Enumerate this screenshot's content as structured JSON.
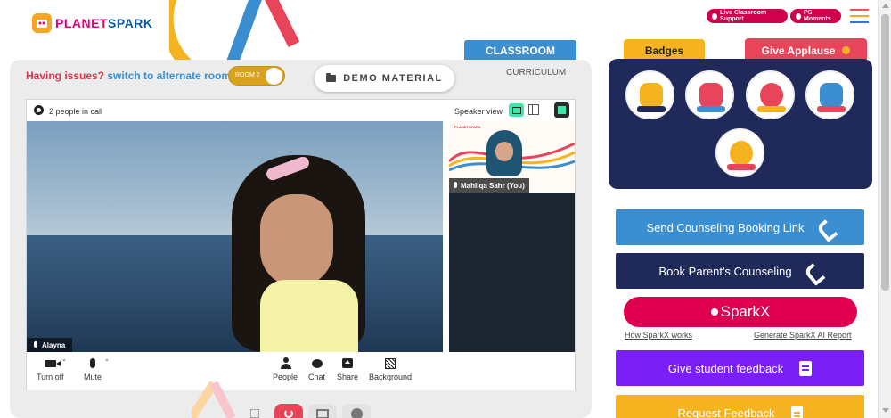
{
  "brand": {
    "logo_part1": "PLANET",
    "logo_part2": "SPARK"
  },
  "header": {
    "live_support": "Live Classroom Support",
    "ps_moments": "PS Moments"
  },
  "tabs": {
    "classroom": "CLASSROOM",
    "curriculum": "CURRICULUM"
  },
  "issues": {
    "prefix": "Having issues?",
    "link": "switch to alternate room"
  },
  "room_toggle": {
    "label": "ROOM 2"
  },
  "demo_material": "DEMO MATERIAL",
  "call": {
    "people_count": "2 people in call",
    "view_mode": "Speaker view",
    "main_participant": "Alayna",
    "side_participant": "Mahliqa Sahr (You)",
    "side_logo": "PLANETSPARK"
  },
  "toolbar": {
    "turn_off": "Turn off",
    "mute": "Mute",
    "people": "People",
    "chat": "Chat",
    "share": "Share",
    "background": "Background"
  },
  "right": {
    "badges_tab": "Badges",
    "applause_tab": "Give Applause",
    "badges": [
      {
        "icon": "trophy-badge-icon",
        "color": "#f5b41f"
      },
      {
        "icon": "superhero-badge-icon",
        "color": "#e8455a"
      },
      {
        "icon": "meditation-badge-icon",
        "color": "#e8455a"
      },
      {
        "icon": "idea-badge-icon",
        "color": "#3b8fd0"
      },
      {
        "icon": "robot-badge-icon",
        "color": "#f5b41f"
      }
    ],
    "send_counseling": "Send Counseling Booking Link",
    "book_counseling": "Book Parent's Counseling",
    "sparkx": "SparkX",
    "how_sparkx": "How SparkX works",
    "generate_report": "Generate SparkX AI Report",
    "give_feedback": "Give student feedback",
    "request_feedback": "Request Feedback"
  },
  "colors": {
    "blue": "#3b8fd0",
    "navy": "#1f2a5a",
    "purple": "#7a1ff5",
    "yellow": "#f5b41f",
    "pink": "#e0004f"
  }
}
